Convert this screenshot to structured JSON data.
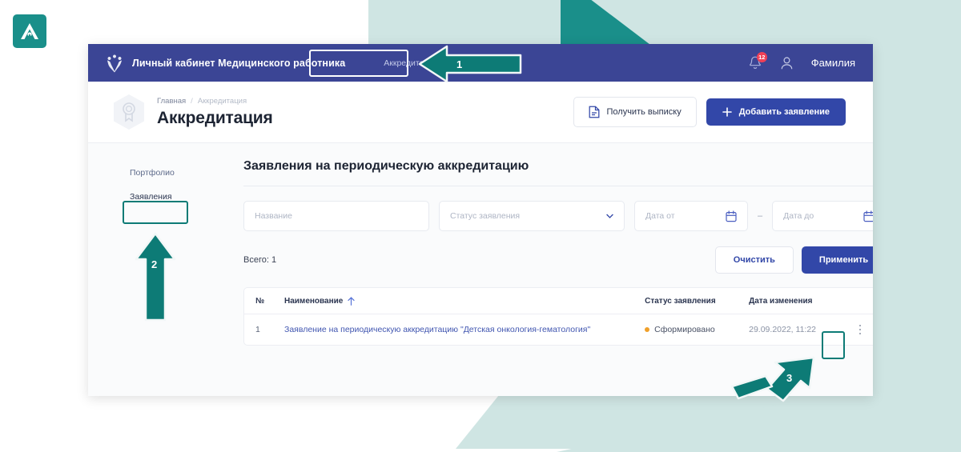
{
  "brand": {
    "logo_icon": "triangle-a-logo"
  },
  "topbar": {
    "emblem_icon": "russian-coat-of-arms-icon",
    "app_title": "Личный кабинет Медицинского работника",
    "nav_item": "Аккредитация",
    "bell_icon": "notification-bell-icon",
    "bell_badge": "12",
    "user_icon": "user-avatar-icon",
    "user_name": "Фамилия"
  },
  "page_header": {
    "icon": "medal-award-hex-icon",
    "breadcrumb": {
      "home": "Главная",
      "separator": "/",
      "current": "Аккредитация"
    },
    "title": "Аккредитация",
    "extract_button": {
      "label": "Получить выписку",
      "icon": "document-icon"
    },
    "add_button": {
      "label": "Добавить заявление",
      "icon": "plus-icon"
    }
  },
  "sidebar": {
    "items": [
      {
        "label": "Портфолио",
        "active": false
      },
      {
        "label": "Заявления",
        "active": true
      }
    ]
  },
  "main": {
    "section_title": "Заявления на периодическую аккредитацию",
    "filters": {
      "name_placeholder": "Название",
      "status_placeholder": "Статус заявления",
      "status_caret_icon": "chevron-down-icon",
      "date_from_placeholder": "Дата от",
      "date_to_placeholder": "Дата до",
      "date_separator": "–",
      "calendar_icon": "calendar-icon"
    },
    "totals_label": "Всего: 1",
    "clear_button": "Очистить",
    "apply_button": "Применить",
    "table": {
      "columns": {
        "num": "№",
        "name": "Наименование",
        "sort_icon": "sort-arrow-up-icon",
        "status": "Статус заявления",
        "date": "Дата изменения"
      },
      "rows": [
        {
          "num": "1",
          "name": "Заявление на периодическую аккредитацию \"Детская онкология-гематология\"",
          "status": "Сформировано",
          "status_color": "#f0a02a",
          "date": "29.09.2022, 11:22",
          "menu_icon": "kebab-menu-icon"
        }
      ]
    }
  },
  "annotations": {
    "markers": [
      {
        "number": "1",
        "direction": "left",
        "target": "top-nav-accreditation-tab"
      },
      {
        "number": "2",
        "direction": "up",
        "target": "sidebar-item-applications"
      },
      {
        "number": "3",
        "direction": "up-right",
        "target": "row-kebab-menu"
      }
    ],
    "accent_color": "#0d7b76"
  }
}
